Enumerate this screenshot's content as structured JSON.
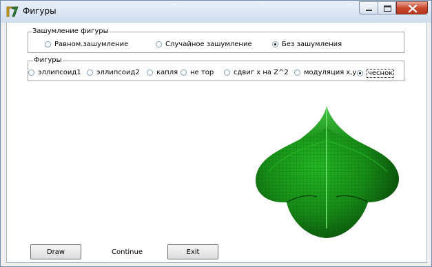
{
  "window": {
    "title": "Фигуры"
  },
  "caption_buttons": {
    "minimize": "minimize",
    "maximize": "maximize",
    "close": "close"
  },
  "shading_group": {
    "title": "Зашумление фигуры",
    "options": [
      {
        "label": "Равном.зашумление",
        "checked": false
      },
      {
        "label": "Случайное зашумление",
        "checked": false
      },
      {
        "label": "Без зашумления",
        "checked": true
      }
    ]
  },
  "figures_group": {
    "title": "Фигуры",
    "options": [
      {
        "label": "эллипсоид1",
        "checked": false
      },
      {
        "label": "эллипсоид2",
        "checked": false
      },
      {
        "label": "капля",
        "checked": false
      },
      {
        "label": "не тор",
        "checked": false
      },
      {
        "label": "сдвиг х  на Z^2",
        "checked": false
      },
      {
        "label": "модуляция x,y",
        "checked": false
      },
      {
        "label": "чеснок",
        "checked": true
      }
    ]
  },
  "render": {
    "shape": "чеснок",
    "color": "#1a8c1a"
  },
  "buttons": {
    "draw": "Draw",
    "continue": "Continue",
    "exit": "Exit"
  }
}
